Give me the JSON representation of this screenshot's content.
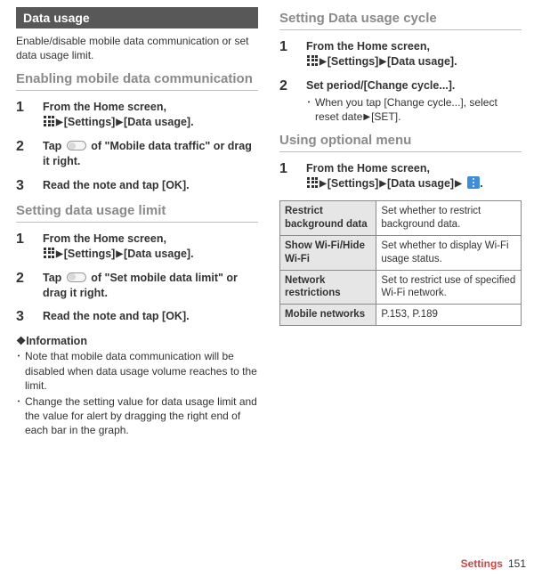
{
  "left": {
    "header": "Data usage",
    "intro": "Enable/disable mobile data communication or set data usage limit.",
    "sectionA": {
      "title": "Enabling mobile data communication",
      "steps": [
        {
          "num": "1",
          "pre": "From the Home screen, ",
          "path1": "[Settings]",
          "path2": "[Data usage]",
          "post": "."
        },
        {
          "num": "2",
          "text": "Tap TOGGLE of \"Mobile data traffic\" or drag it right."
        },
        {
          "num": "3",
          "text": "Read the note and tap [OK]."
        }
      ]
    },
    "sectionB": {
      "title": "Setting data usage limit",
      "steps": [
        {
          "num": "1",
          "pre": "From the Home screen, ",
          "path1": "[Settings]",
          "path2": "[Data usage]",
          "post": "."
        },
        {
          "num": "2",
          "text": "Tap TOGGLE of \"Set mobile data limit\" or drag it right."
        },
        {
          "num": "3",
          "text": "Read the note and tap [OK]."
        }
      ],
      "infoHead": "❖Information",
      "infoItems": [
        "Note that mobile data communication will be disabled when data usage volume reaches to the limit.",
        "Change the setting value for data usage limit and the value for alert by dragging the right end of each bar in the graph."
      ]
    }
  },
  "right": {
    "sectionC": {
      "title": "Setting Data usage cycle",
      "steps": [
        {
          "num": "1",
          "pre": "From the Home screen, ",
          "path1": "[Settings]",
          "path2": "[Data usage]",
          "post": "."
        },
        {
          "num": "2",
          "main": "Set period/[Change cycle...].",
          "subPre": "When you tap [Change cycle...], select reset date",
          "subPost": "[SET]."
        }
      ]
    },
    "sectionD": {
      "title": "Using optional menu",
      "step": {
        "num": "1",
        "pre": "From the Home screen, ",
        "path1": "[Settings]",
        "path2": "[Data usage]"
      },
      "table": [
        {
          "label": "Restrict background data",
          "desc": "Set whether to restrict background data."
        },
        {
          "label": "Show Wi-Fi/Hide Wi-Fi",
          "desc": "Set whether to display Wi-Fi usage status."
        },
        {
          "label": "Network restrictions",
          "desc": "Set to restrict use of specified Wi-Fi network."
        },
        {
          "label": "Mobile networks",
          "desc": "P.153, P.189"
        }
      ]
    }
  },
  "footer": {
    "section": "Settings",
    "page": "151"
  }
}
